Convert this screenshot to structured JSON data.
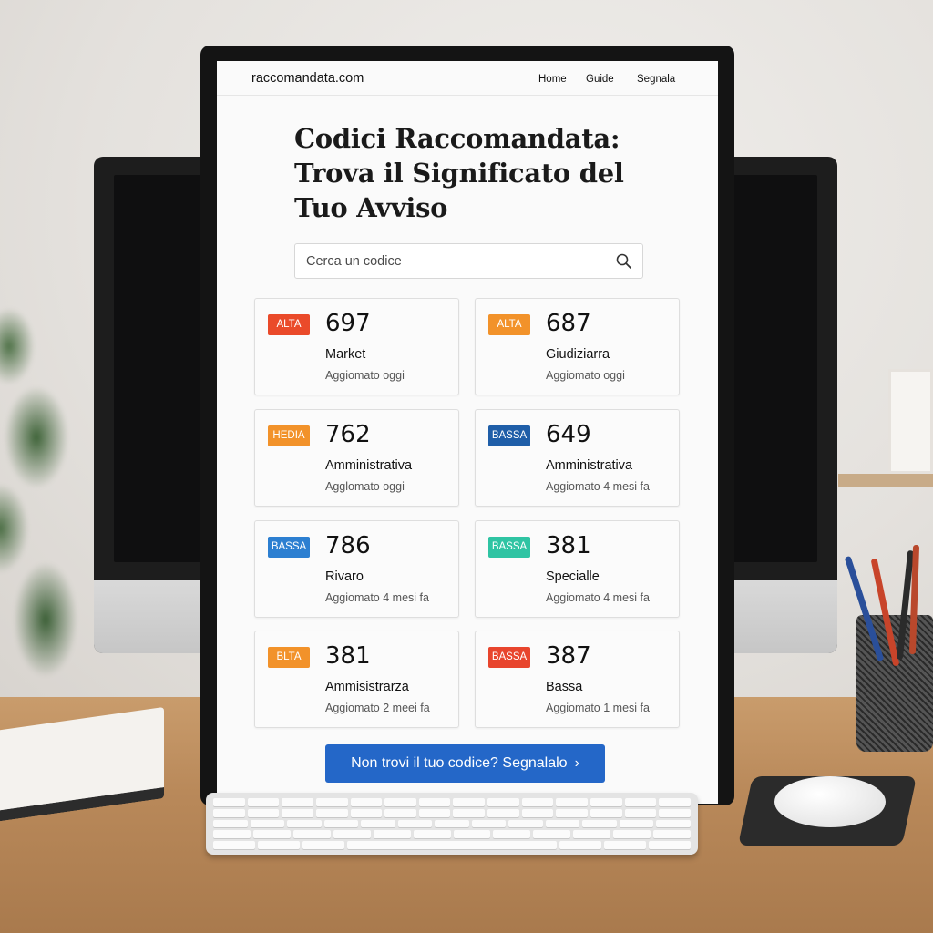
{
  "site": {
    "brand": "raccomandata.com",
    "nav": [
      "Home",
      "Guide",
      "Segnala"
    ]
  },
  "hero": {
    "title": "Codici Raccomandata: Trova il Significato del Tuo Avviso"
  },
  "search": {
    "placeholder": "Cerca un codice",
    "icon": "search-icon"
  },
  "cards": [
    {
      "badge": "ALTA",
      "badge_color": "#ea4a2a",
      "code": "697",
      "category": "Market",
      "updated": "Aggiomato oggi"
    },
    {
      "badge": "ALTA",
      "badge_color": "#f2922a",
      "code": "687",
      "category": "Giudiziarra",
      "updated": "Aggiomato oggi"
    },
    {
      "badge": "HEDIA",
      "badge_color": "#f2922a",
      "code": "762",
      "category": "Amministrativa",
      "updated": "Agglomato oggi"
    },
    {
      "badge": "BASSA",
      "badge_color": "#1f5ea8",
      "code": "649",
      "category": "Amministrativa",
      "updated": "Aggiomato 4 mesi fa"
    },
    {
      "badge": "BASSA",
      "badge_color": "#2c7fd1",
      "code": "786",
      "category": "Rivaro",
      "updated": "Aggiomato 4 mesi fa"
    },
    {
      "badge": "BASSA",
      "badge_color": "#2fc4a3",
      "code": "381",
      "category": "Specialle",
      "updated": "Aggiomato 4 mesi fa"
    },
    {
      "badge": "BLTA",
      "badge_color": "#f2922a",
      "code": "381",
      "category": "Ammisistrarza",
      "updated": "Aggiomato 2 meei fa"
    },
    {
      "badge": "BASSA",
      "badge_color": "#e8452d",
      "code": "387",
      "category": "Bassa",
      "updated": "Aggiomato 1 mesi fa"
    }
  ],
  "cta": {
    "label": "Non trovi il tuo codice? Segnalalo",
    "arrow": "›"
  }
}
